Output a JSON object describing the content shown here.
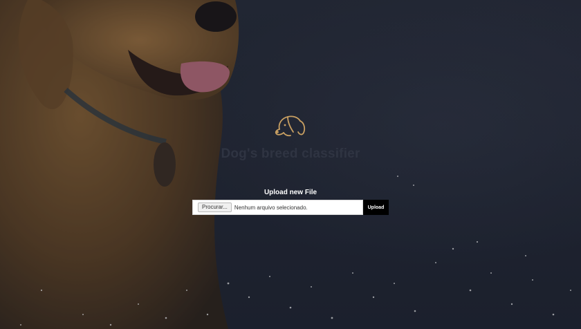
{
  "app": {
    "title": "Dog's breed classifier",
    "logo_icon": "dog-head-icon"
  },
  "upload": {
    "heading": "Upload new File",
    "browse_label": "Procurar...",
    "file_status": "Nenhum arquivo selecionado.",
    "submit_label": "Upload"
  },
  "colors": {
    "background": "#232835",
    "title_muted": "#2f3442",
    "logo_gold": "#c9a062",
    "submit_bg": "#000000"
  }
}
